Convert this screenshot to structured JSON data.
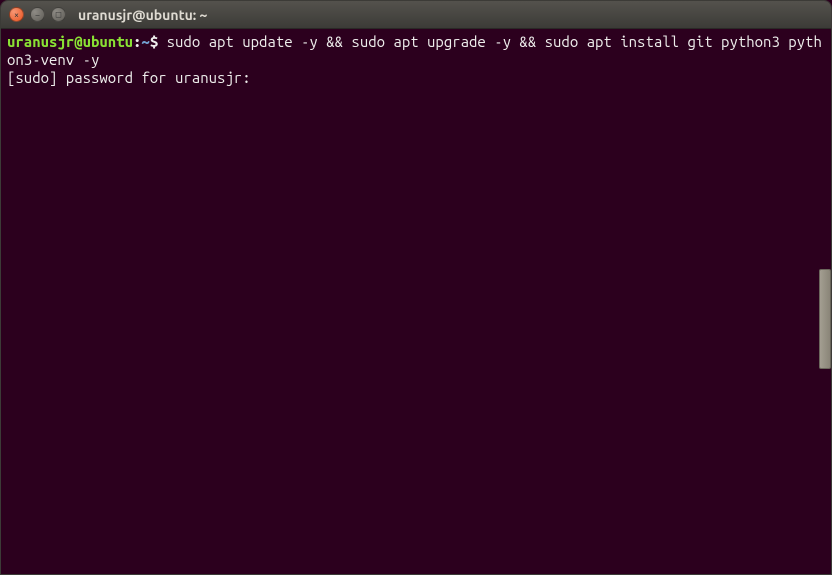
{
  "titlebar": {
    "title": "uranusjr@ubuntu: ~"
  },
  "terminal": {
    "prompt": {
      "user_host": "uranusjr@ubuntu",
      "colon": ":",
      "path": "~",
      "symbol": "$"
    },
    "command": " sudo apt update -y && sudo apt upgrade -y && sudo apt install git python3 python3-venv -y",
    "output": "[sudo] password for uranusjr:"
  },
  "icons": {
    "close": "×",
    "minimize": "−",
    "maximize": "□"
  }
}
